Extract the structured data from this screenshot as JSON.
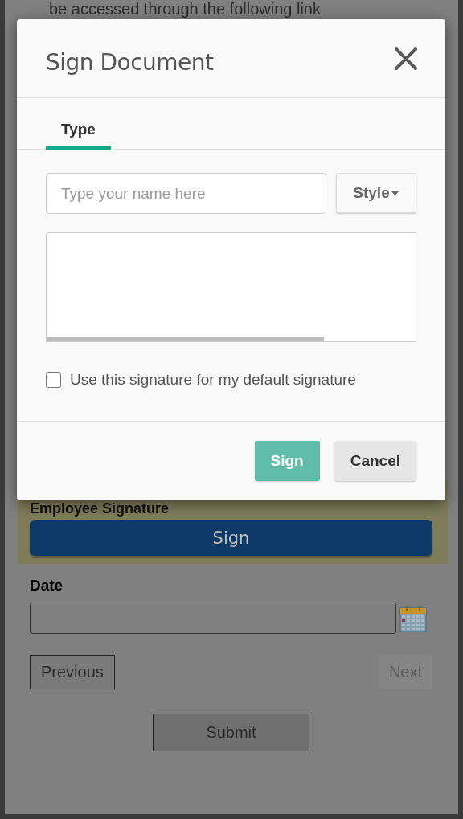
{
  "background_page": {
    "intro_text": "be accessed through the following link",
    "signature_section": {
      "label": "Employee Signature",
      "button": "Sign"
    },
    "date_field": {
      "label": "Date"
    },
    "previous_button": {
      "label": "Previous",
      "disabled": false
    },
    "next_button": {
      "label": "Next",
      "disabled": true
    },
    "submit_button": {
      "label": "Submit"
    }
  },
  "dialog": {
    "title": "Sign Document",
    "tabs": [
      {
        "label": "Type",
        "selected": true
      }
    ],
    "name_field": {
      "placeholder": "Type your name here"
    },
    "style_button": {
      "label": "Style"
    },
    "default_checkbox": {
      "label": "Use this signature for my default signature",
      "checked": false
    },
    "buttons": [
      {
        "label": "Sign",
        "kind": "primary"
      },
      {
        "label": "Cancel",
        "kind": "secondary"
      }
    ]
  }
}
